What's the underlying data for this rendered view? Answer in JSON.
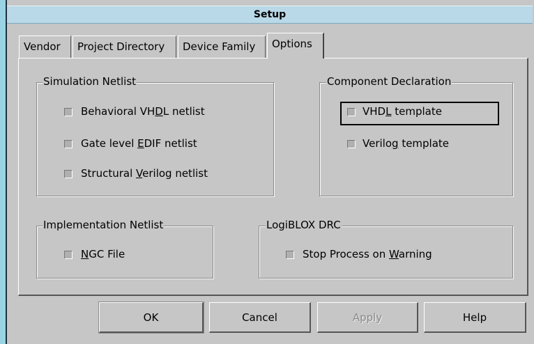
{
  "window": {
    "title": "Setup"
  },
  "tabs": [
    {
      "label": "Vendor"
    },
    {
      "label": "Project Directory"
    },
    {
      "label": "Device Family"
    },
    {
      "label": "Options",
      "active": true
    }
  ],
  "groups": {
    "simulation": {
      "label": "Simulation Netlist",
      "items": [
        {
          "pre": "Behavioral VH",
          "mn": "D",
          "post": "L netlist",
          "checked": true
        },
        {
          "pre": "Gate level ",
          "mn": "E",
          "post": "DIF netlist",
          "checked": false
        },
        {
          "pre": "Structural ",
          "mn": "V",
          "post": "erilog netlist",
          "checked": false
        }
      ]
    },
    "component": {
      "label": "Component Declaration",
      "items": [
        {
          "pre": "VHD",
          "mn": "L",
          "post": " template",
          "checked": true
        },
        {
          "pre": "Verilo",
          "mn": "g",
          "post": " template",
          "checked": false
        }
      ]
    },
    "implementation": {
      "label": "Implementation Netlist",
      "items": [
        {
          "pre": "",
          "mn": "N",
          "post": "GC File",
          "checked": true
        }
      ]
    },
    "logiblox": {
      "label": "LogiBLOX DRC",
      "items": [
        {
          "pre": "Stop Process on ",
          "mn": "W",
          "post": "arning",
          "checked": true
        }
      ]
    }
  },
  "buttons": {
    "ok": "OK",
    "cancel": "Cancel",
    "apply": "Apply",
    "help": "Help"
  }
}
